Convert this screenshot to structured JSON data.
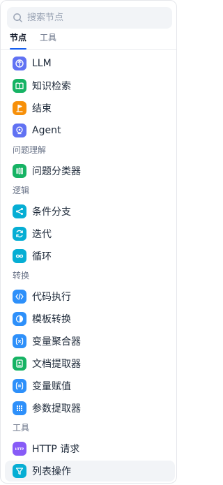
{
  "search": {
    "placeholder": "搜索节点"
  },
  "tabs": [
    {
      "label": "节点",
      "active": true
    },
    {
      "label": "工具",
      "active": false
    }
  ],
  "items": [
    {
      "label": "LLM",
      "icon": "llm-icon",
      "color": "#6172f3"
    },
    {
      "label": "知识检索",
      "icon": "knowledge-retrieval-icon",
      "color": "#16b364"
    },
    {
      "label": "结束",
      "icon": "end-icon",
      "color": "#f79009"
    },
    {
      "label": "Agent",
      "icon": "agent-icon",
      "color": "#6172f3"
    }
  ],
  "sections": {
    "qa": {
      "title": "问题理解",
      "items": [
        {
          "label": "问题分类器",
          "icon": "question-classifier-icon",
          "color": "#16b364"
        }
      ]
    },
    "logic": {
      "title": "逻辑",
      "items": [
        {
          "label": "条件分支",
          "icon": "if-else-icon",
          "color": "#06aed4"
        },
        {
          "label": "迭代",
          "icon": "iteration-icon",
          "color": "#06aed4"
        },
        {
          "label": "循环",
          "icon": "loop-icon",
          "color": "#06aed4"
        }
      ]
    },
    "transform": {
      "title": "转换",
      "items": [
        {
          "label": "代码执行",
          "icon": "code-icon",
          "color": "#2e90fa"
        },
        {
          "label": "模板转换",
          "icon": "template-transform-icon",
          "color": "#2e90fa"
        },
        {
          "label": "变量聚合器",
          "icon": "variable-aggregator-icon",
          "color": "#2e90fa"
        },
        {
          "label": "文档提取器",
          "icon": "document-extractor-icon",
          "color": "#16b364"
        },
        {
          "label": "变量赋值",
          "icon": "variable-assigner-icon",
          "color": "#2e90fa"
        },
        {
          "label": "参数提取器",
          "icon": "parameter-extractor-icon",
          "color": "#2e90fa"
        }
      ]
    },
    "tools": {
      "title": "工具",
      "items": [
        {
          "label": "HTTP 请求",
          "icon": "http-request-icon",
          "color": "#875bf7"
        },
        {
          "label": "列表操作",
          "icon": "list-operator-icon",
          "color": "#06aed4",
          "hovered": true
        }
      ]
    }
  }
}
